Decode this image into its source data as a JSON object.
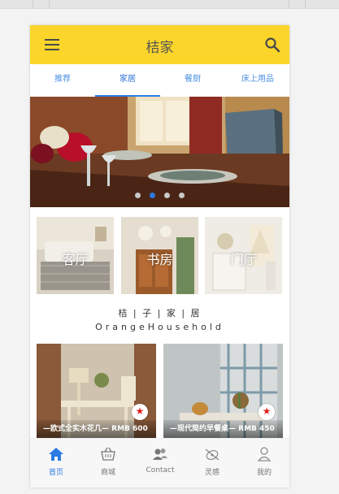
{
  "app": {
    "title": "桔家"
  },
  "tabs": [
    "推荐",
    "家居",
    "餐厨",
    "床上用品"
  ],
  "active_tab": 1,
  "banner": {
    "dot_count": 4,
    "active_dot": 1
  },
  "categories": [
    "客厅",
    "书房",
    "门厅"
  ],
  "brand": {
    "cn": "桔 | 子 | 家 | 居",
    "en": "OrangeHousehold"
  },
  "products": [
    {
      "caption": "—欧式全实木花几— RMB 600"
    },
    {
      "caption": "—现代简约早餐桌— RMB 450"
    }
  ],
  "bottom_nav": [
    {
      "label": "首页",
      "icon": "home-icon"
    },
    {
      "label": "商城",
      "icon": "basket-icon"
    },
    {
      "label": "Contact",
      "icon": "contacts-icon"
    },
    {
      "label": "灵感",
      "icon": "inspiration-icon"
    },
    {
      "label": "我的",
      "icon": "user-icon"
    }
  ],
  "active_nav": 0,
  "colors": {
    "accent": "#fbd52a",
    "active": "#2a7be4",
    "tab_text": "#4a90e2"
  }
}
